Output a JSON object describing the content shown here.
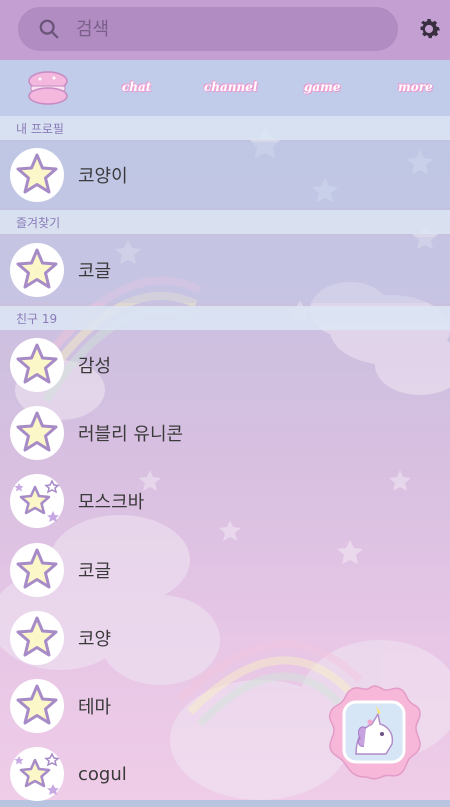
{
  "search": {
    "placeholder": "검색"
  },
  "tabs": [
    {
      "label": "chat"
    },
    {
      "label": "channel"
    },
    {
      "label": "game"
    },
    {
      "label": "more"
    }
  ],
  "sections": {
    "my_profile": "내 프로필",
    "favorites": "즐겨찾기",
    "friends": "친구 19"
  },
  "profile": {
    "name": "코양이"
  },
  "favorites": [
    {
      "name": "코글"
    }
  ],
  "friends": [
    {
      "name": "감성"
    },
    {
      "name": "러블리 유니콘"
    },
    {
      "name": "모스크바"
    },
    {
      "name": "코글"
    },
    {
      "name": "코양"
    },
    {
      "name": "테마"
    },
    {
      "name": "cogul"
    }
  ],
  "colors": {
    "topbar": "#c39fd2",
    "tabbar": "#c0ccea",
    "star_fill": "#fbf7c8",
    "star_stroke": "#a78bc7"
  },
  "icons": {
    "search": "search-icon",
    "settings": "gear-icon",
    "home": "macaron-icon",
    "avatar": "star-icon",
    "fab": "unicorn-icon"
  }
}
